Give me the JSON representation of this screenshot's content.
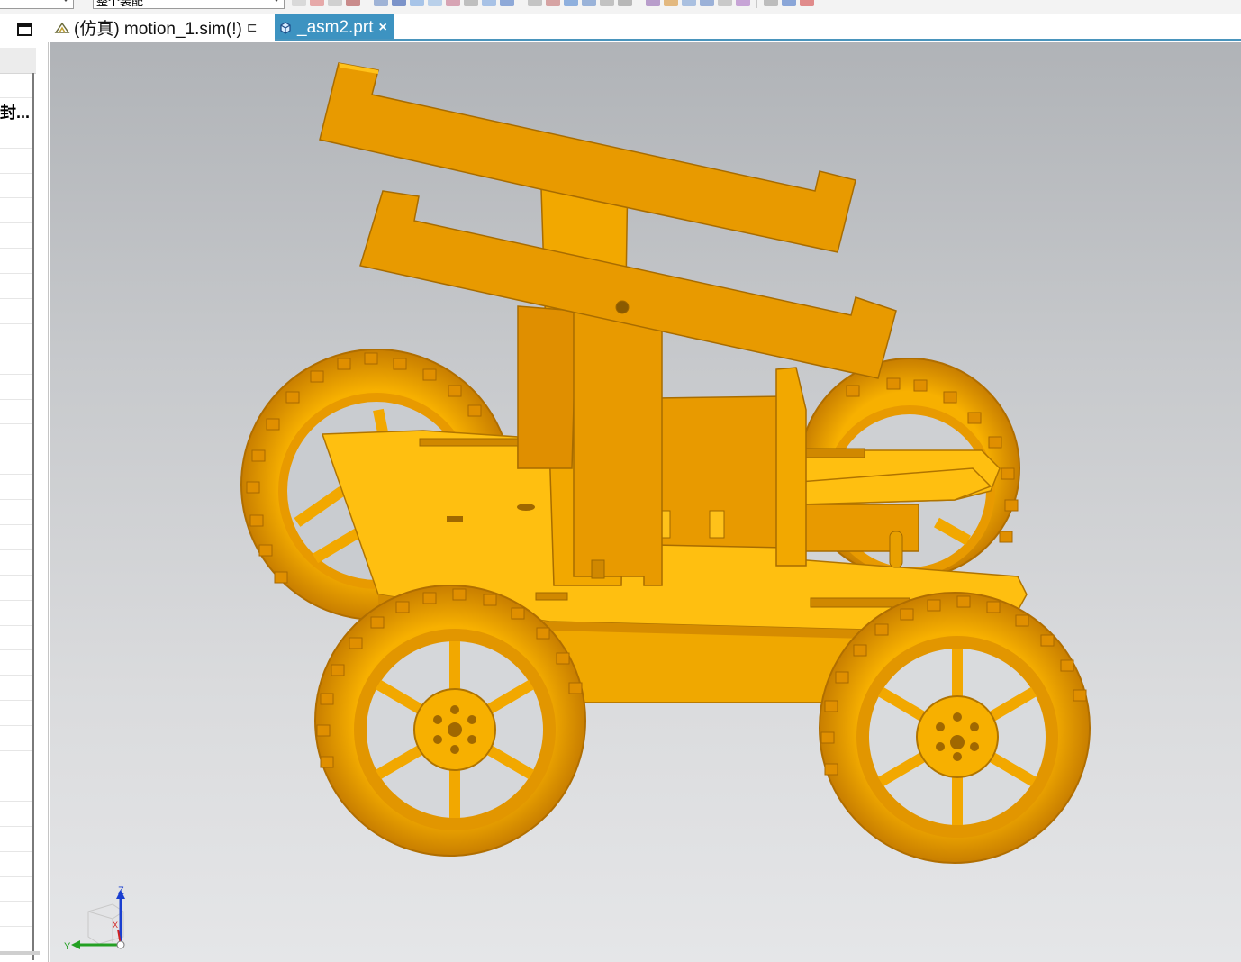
{
  "toolbar": {
    "assembly_filter_value": "整个装配",
    "icons": [
      "orient-icon",
      "view-icon",
      "render-icon",
      "snap-icon",
      "constraint-icon",
      "measure-icon",
      "layer-icon",
      "section-icon"
    ]
  },
  "tabs": [
    {
      "label": "(仿真) motion_1.sim(!)",
      "icon": "simulation-icon",
      "active": false,
      "suffix": "⊏"
    },
    {
      "label": "_asm2.prt",
      "icon": "assembly-part-icon",
      "active": true,
      "close": "×"
    }
  ],
  "left_panel": {
    "visible_label": "封..."
  },
  "viewport": {
    "model": "cart-assembly",
    "triad": {
      "z": "Z",
      "y": "Y",
      "x": "X"
    }
  },
  "colors": {
    "accent": "#3d93c1",
    "model_fill": "#f2a800",
    "model_dark": "#c77a00",
    "model_light": "#ffc21a"
  }
}
